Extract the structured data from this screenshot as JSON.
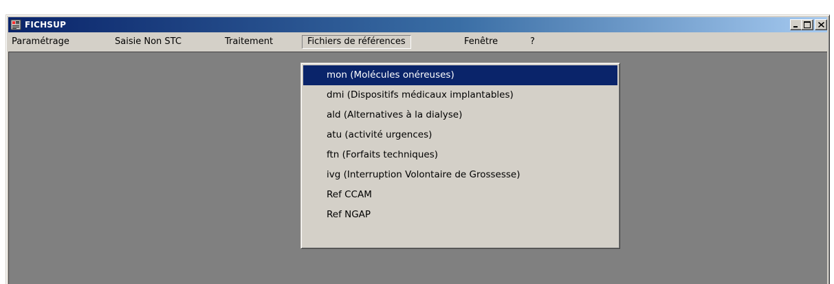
{
  "window": {
    "title": "FICHSUP",
    "title_gradient": [
      "#0a246a",
      "#a6caf0"
    ],
    "caption_buttons": [
      "minimize-icon",
      "maximize-icon",
      "close-icon"
    ]
  },
  "menubar": {
    "items": [
      {
        "label": "Paramétrage"
      },
      {
        "label": "Saisie Non STC"
      },
      {
        "label": "Traitement"
      },
      {
        "label": "Fichiers de références",
        "open": true
      },
      {
        "label": "Fenêtre"
      },
      {
        "label": "?"
      }
    ]
  },
  "dropdown": {
    "items": [
      {
        "label": "mon (Molécules onéreuses)",
        "selected": true
      },
      {
        "label": "dmi (Dispositifs médicaux implantables)"
      },
      {
        "label": "ald (Alternatives à la dialyse)"
      },
      {
        "label": "atu (activité urgences)"
      },
      {
        "label": "ftn (Forfaits techniques)"
      },
      {
        "label": "ivg (Interruption Volontaire de Grossesse)"
      },
      {
        "label": "Ref CCAM"
      },
      {
        "label": "Ref NGAP"
      }
    ],
    "highlight_color": "#0a246a"
  }
}
